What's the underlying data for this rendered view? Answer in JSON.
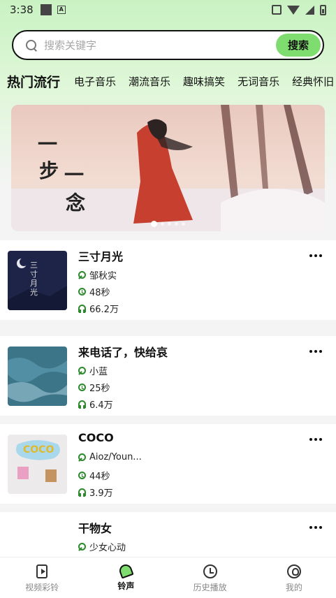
{
  "status_bar": {
    "time": "3:38",
    "notif_icon_letter": "A"
  },
  "search": {
    "placeholder": "搜索关键字",
    "button_label": "搜索"
  },
  "tabs": [
    {
      "label": "热门流行",
      "active": true
    },
    {
      "label": "电子音乐"
    },
    {
      "label": "潮流音乐"
    },
    {
      "label": "趣味搞笑"
    },
    {
      "label": "无词音乐"
    },
    {
      "label": "经典怀旧"
    }
  ],
  "banner": {
    "calligraphy": [
      "一",
      "步",
      "一",
      "念"
    ],
    "active_dot": 0,
    "dot_count": 5
  },
  "songs": [
    {
      "title": "三寸月光",
      "artist": "邹秋实",
      "duration": "48秒",
      "plays": "66.2万",
      "cover_text": "三寸月光"
    },
    {
      "title": "来电话了，快给哀",
      "artist": "小蓝",
      "duration": "25秒",
      "plays": "6.4万"
    },
    {
      "title": "COCO",
      "artist": "Aioz/Youn...",
      "duration": "44秒",
      "plays": "3.9万",
      "cover_text": "COCO"
    },
    {
      "title": "干物女",
      "artist": "少女心动"
    }
  ],
  "nav": [
    {
      "label": "视频彩铃",
      "icon": "video-icon"
    },
    {
      "label": "铃声",
      "icon": "bell-icon",
      "active": true
    },
    {
      "label": "历史播放",
      "icon": "clock-icon"
    },
    {
      "label": "我的",
      "icon": "profile-icon"
    }
  ],
  "colors": {
    "accent": "#7fdc6f",
    "icon_green": "#2b8a2b",
    "header_gradient_top": "#c9f2c2"
  }
}
